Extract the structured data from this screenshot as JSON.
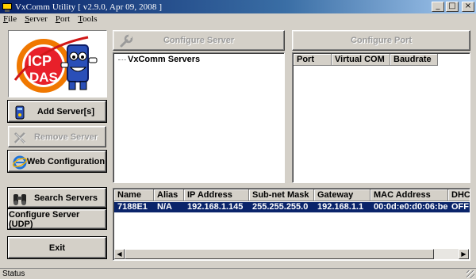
{
  "window": {
    "title": "VxComm Utility [ v2.9.0, Apr 09, 2008 ]"
  },
  "menu": [
    {
      "u": "F",
      "rest": "ile"
    },
    {
      "u": "S",
      "rest": "erver"
    },
    {
      "u": "P",
      "rest": "ort"
    },
    {
      "u": "T",
      "rest": "ools"
    }
  ],
  "logo": {
    "line1": "ICP",
    "line2": "DAS"
  },
  "buttons": {
    "add_server": "Add Server[s]",
    "remove_server": "Remove Server",
    "web_configuration": "Web Configuration",
    "search_servers": "Search Servers",
    "configure_server_udp": "Configure Server (UDP)",
    "exit": "Exit",
    "configure_server": "Configure Server",
    "configure_port": "Configure Port"
  },
  "tree": {
    "root": "VxComm Servers"
  },
  "port_table": {
    "columns": [
      "Port",
      "Virtual COM",
      "Baudrate"
    ]
  },
  "server_table": {
    "columns": [
      "Name",
      "Alias",
      "IP Address",
      "Sub-net Mask",
      "Gateway",
      "MAC Address",
      "DHC"
    ],
    "rows": [
      [
        "7188E1",
        "N/A",
        "192.168.1.145",
        "255.255.255.0",
        "192.168.1.1",
        "00:0d:e0:d0:06:be",
        "OFF"
      ]
    ]
  },
  "status": {
    "text": "Status"
  },
  "colors": {
    "titlebar_start": "#0a246a",
    "selection": "#0a246a",
    "face": "#d4d0c8"
  }
}
